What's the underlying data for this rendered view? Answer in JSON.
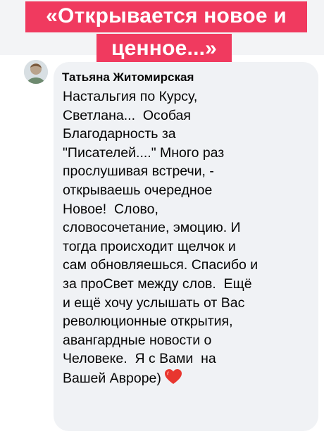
{
  "banner": {
    "line1": "«Открывается новое и",
    "line2": "ценное...»",
    "color": "#f03a5f"
  },
  "comment": {
    "author": "Татьяна Житомирская",
    "lines": [
      "Настальгия по Курсу,",
      "Светлана...  Особая",
      "Благодарность за",
      "\"Писателей....\" Много раз",
      "прослушивая встречи, -",
      "открываешь очередное",
      "Новое!  Слово,",
      "словосочетание, эмоцию. И",
      "тогда происходит щелчок и",
      "сам обновляешься. Спасибо и",
      "за проСвет между слов.  Ещё",
      "и ещё хочу услышать от Вас",
      "революционные открытия,",
      "авангардные новости о",
      "Человеке.  Я с Вами  на",
      "Вашей Авроре)"
    ],
    "emoji_icon": "red-heart-icon"
  }
}
